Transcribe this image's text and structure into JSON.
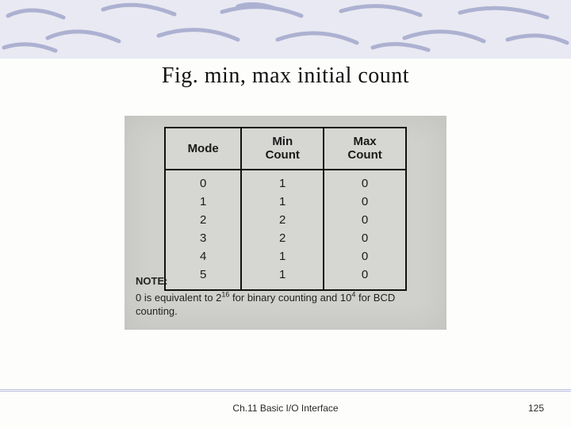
{
  "title": "Fig. min, max initial count",
  "table": {
    "headers": {
      "mode": "Mode",
      "min": "Min\nCount",
      "max": "Max\nCount"
    },
    "rows": [
      {
        "mode": "0",
        "min": "1",
        "max": "0"
      },
      {
        "mode": "1",
        "min": "1",
        "max": "0"
      },
      {
        "mode": "2",
        "min": "2",
        "max": "0"
      },
      {
        "mode": "3",
        "min": "2",
        "max": "0"
      },
      {
        "mode": "4",
        "min": "1",
        "max": "0"
      },
      {
        "mode": "5",
        "min": "1",
        "max": "0"
      }
    ]
  },
  "note": {
    "label": "NOTE:",
    "text_pre": "0 is equivalent to 2",
    "exp1": "16",
    "text_mid": " for binary counting and 10",
    "exp2": "4",
    "text_post": " for BCD counting."
  },
  "footer": {
    "center": "Ch.11 Basic I/O Interface",
    "page": "125"
  }
}
